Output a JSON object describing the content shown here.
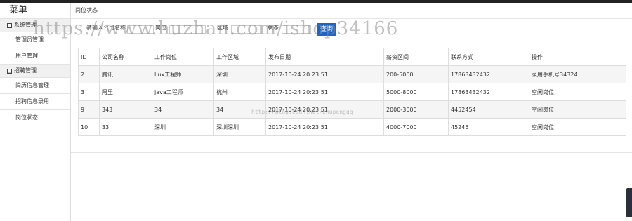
{
  "sidebar": {
    "title": "菜单",
    "groups": [
      {
        "label": "系统管理",
        "items": [
          "管理员管理",
          "用户管理"
        ]
      },
      {
        "label": "招聘管理",
        "items": [
          "简历信息管理",
          "招聘信息录用",
          "岗位状态"
        ]
      }
    ]
  },
  "breadcrumb": "岗位状态",
  "filter": {
    "company_label": "请输入公司名称",
    "job_label": "岗位",
    "area_label": "区域",
    "status_label": "状态",
    "search_button": "查询"
  },
  "table": {
    "headers": [
      "ID",
      "公司名称",
      "工作岗位",
      "工作区域",
      "发布日期",
      "薪资区间",
      "联系方式",
      "操作"
    ],
    "rows": [
      [
        "2",
        "腾讯",
        "liux工程师",
        "深圳",
        "2017-10-24 20:23:51",
        "200-5000",
        "17863432432",
        "录用手机号34324"
      ],
      [
        "3",
        "阿里",
        "java工程师",
        "杭州",
        "2017-10-24 20:23:51",
        "5000-8000",
        "17863432432",
        "空闲岗位"
      ],
      [
        "9",
        "343",
        "34",
        "34",
        "2017-10-24 20:23:51",
        "2000-3000",
        "4452454",
        "空闲岗位"
      ],
      [
        "10",
        "33",
        "深圳",
        "深圳深圳",
        "2017-10-24 20:23:51",
        "4000-7000",
        "45245",
        "空闲岗位"
      ]
    ]
  },
  "watermarks": {
    "main": "https://www.huzhan.com/ishop34166",
    "blog": "http://blog.csdn.net/zhupengqq"
  },
  "colors": {
    "search_button": "#1e63c7",
    "top_bar": "#222222"
  }
}
